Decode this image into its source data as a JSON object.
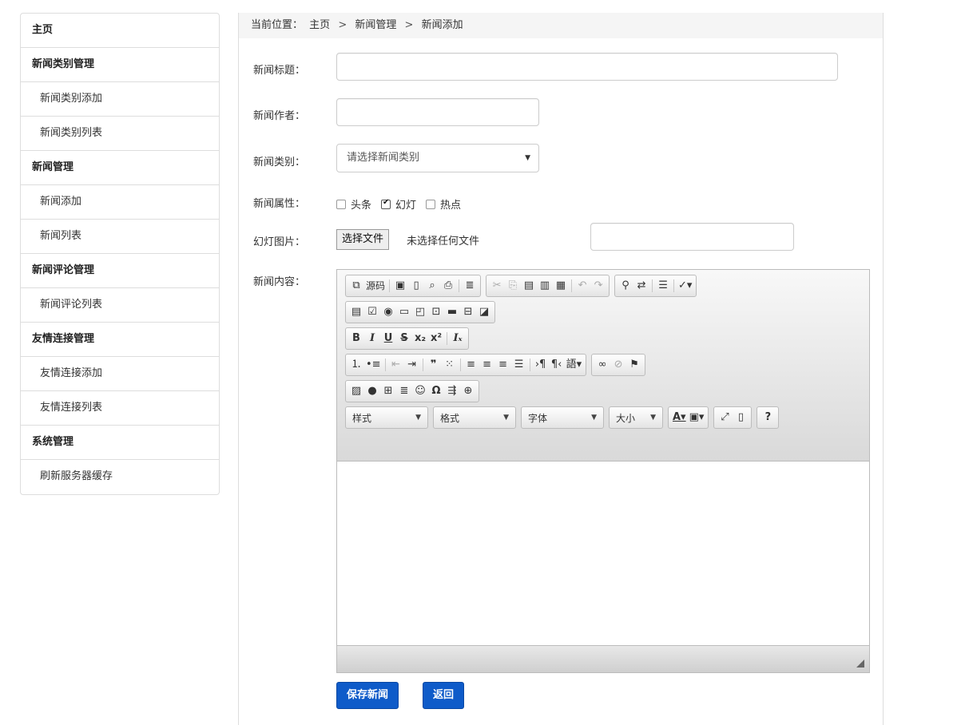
{
  "sidebar": {
    "items": [
      {
        "label": "主页",
        "type": "group"
      },
      {
        "label": "新闻类别管理",
        "type": "group"
      },
      {
        "label": "新闻类别添加",
        "type": "sub"
      },
      {
        "label": "新闻类别列表",
        "type": "sub"
      },
      {
        "label": "新闻管理",
        "type": "group"
      },
      {
        "label": "新闻添加",
        "type": "sub"
      },
      {
        "label": "新闻列表",
        "type": "sub"
      },
      {
        "label": "新闻评论管理",
        "type": "group"
      },
      {
        "label": "新闻评论列表",
        "type": "sub"
      },
      {
        "label": "友情连接管理",
        "type": "group"
      },
      {
        "label": "友情连接添加",
        "type": "sub"
      },
      {
        "label": "友情连接列表",
        "type": "sub"
      },
      {
        "label": "系统管理",
        "type": "group"
      },
      {
        "label": "刷新服务器缓存",
        "type": "sub"
      }
    ]
  },
  "breadcrumb": {
    "prefix": "当前位置：",
    "items": [
      "主页",
      "新闻管理",
      "新闻添加"
    ],
    "separator": ">"
  },
  "form": {
    "title_label": "新闻标题：",
    "title_value": "",
    "author_label": "新闻作者：",
    "author_value": "",
    "category_label": "新闻类别：",
    "category_selected": "请选择新闻类别",
    "attr_label": "新闻属性：",
    "attrs": [
      {
        "label": "头条",
        "checked": false
      },
      {
        "label": "幻灯",
        "checked": true
      },
      {
        "label": "热点",
        "checked": false
      }
    ],
    "image_label": "幻灯图片：",
    "file_button": "选择文件",
    "file_status": "未选择任何文件",
    "image_path_value": "",
    "content_label": "新闻内容："
  },
  "editor": {
    "source_label": "源码",
    "combos": [
      "样式",
      "格式",
      "字体",
      "大小"
    ],
    "help_label": "?"
  },
  "actions": {
    "save": "保存新闻",
    "back": "返回"
  },
  "colors": {
    "primary": "#0e5bc9",
    "border": "#dddddd",
    "crumb_bg": "#f5f5f5"
  }
}
